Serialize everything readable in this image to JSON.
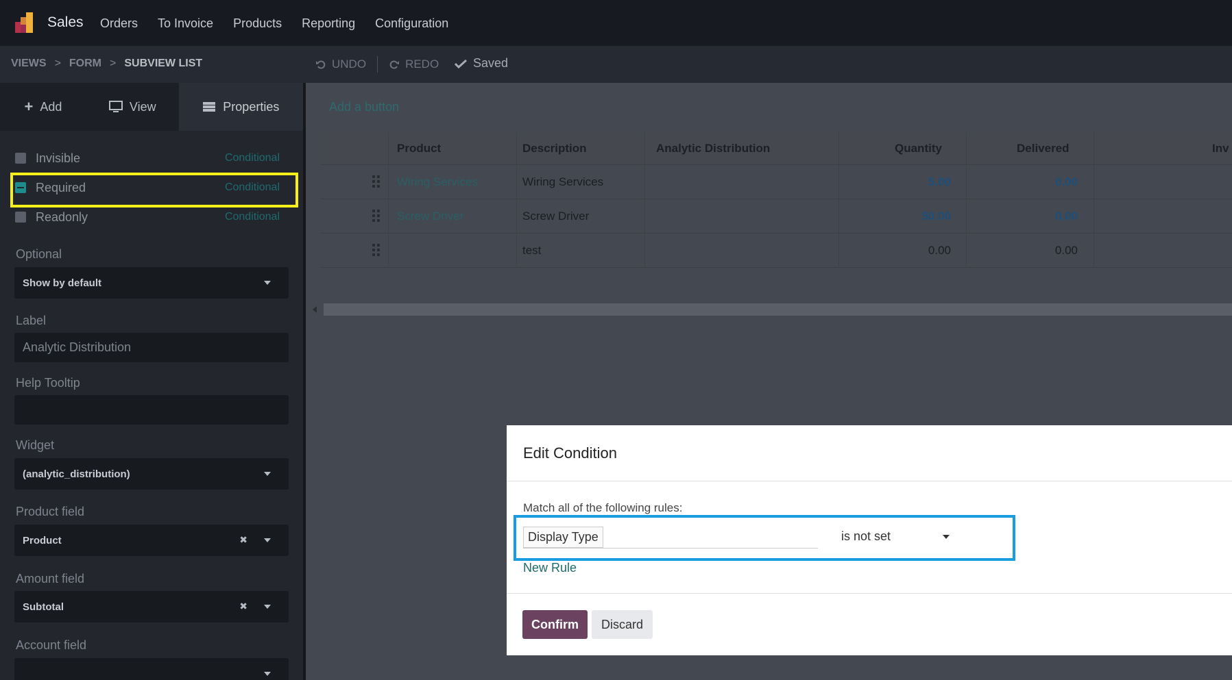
{
  "app": {
    "name": "Sales"
  },
  "menu": [
    "Orders",
    "To Invoice",
    "Products",
    "Reporting",
    "Configuration"
  ],
  "breadcrumb": {
    "views": "VIEWS",
    "form": "FORM",
    "current": "SUBVIEW LIST",
    "sep": ">"
  },
  "toolbar": {
    "undo": "UNDO",
    "redo": "REDO",
    "saved": "Saved"
  },
  "sidebar": {
    "tabs": {
      "add": "Add",
      "view": "View",
      "properties": "Properties"
    },
    "props": [
      {
        "label": "Invisible",
        "cond": "Conditional"
      },
      {
        "label": "Required",
        "cond": "Conditional"
      },
      {
        "label": "Readonly",
        "cond": "Conditional"
      }
    ],
    "optional": {
      "label": "Optional",
      "value": "Show by default"
    },
    "field_label": {
      "label": "Label",
      "value": "Analytic Distribution"
    },
    "help_tooltip": {
      "label": "Help Tooltip",
      "value": ""
    },
    "widget": {
      "label": "Widget",
      "value": "(analytic_distribution)"
    },
    "product_field": {
      "label": "Product field",
      "value": "Product"
    },
    "amount_field": {
      "label": "Amount field",
      "value": "Subtotal"
    },
    "account_field": {
      "label": "Account field",
      "value": ""
    }
  },
  "main": {
    "add_button": "Add a button",
    "columns": [
      "Product",
      "Description",
      "Analytic Distribution",
      "Quantity",
      "Delivered",
      "Inv"
    ],
    "rows": [
      {
        "product": "Wiring Services",
        "description": "Wiring Services",
        "quantity": "5.00",
        "delivered": "0.00"
      },
      {
        "product": "Screw Driver",
        "description": "Screw Driver",
        "quantity": "50.00",
        "delivered": "0.00"
      },
      {
        "product": "",
        "description": "test",
        "quantity": "0.00",
        "delivered": "0.00"
      }
    ]
  },
  "dialog": {
    "title": "Edit Condition",
    "match_text": "Match all of the following rules:",
    "rule_field": "Display Type",
    "rule_operator": "is not set",
    "new_rule": "New Rule",
    "confirm": "Confirm",
    "discard": "Discard"
  },
  "colors": {
    "accent": "#6b4360",
    "highlight_yellow": "#f5ef1a",
    "highlight_blue": "#1a9de0",
    "link": "#1d6b6f"
  }
}
